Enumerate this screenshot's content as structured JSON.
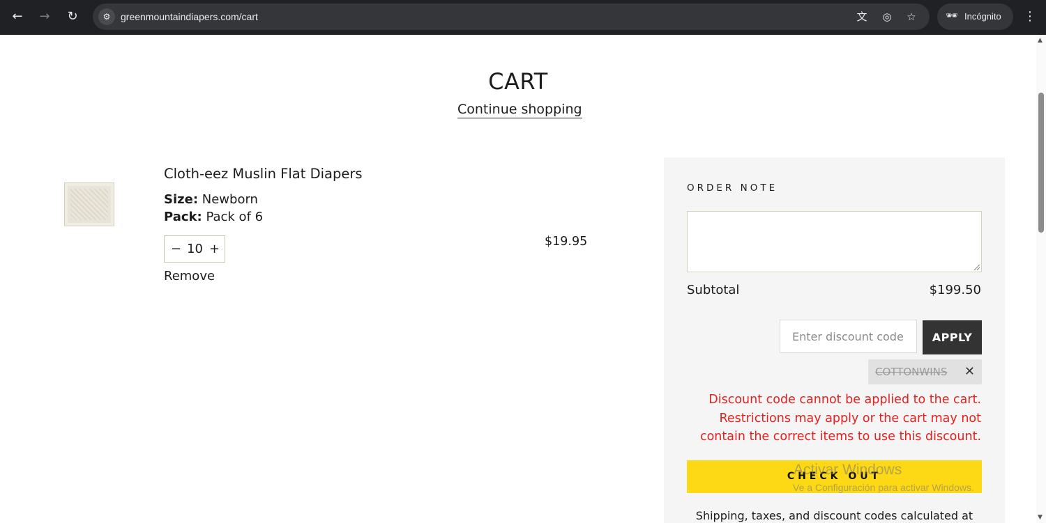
{
  "browser": {
    "url": "greenmountaindiapers.com/cart",
    "profile_label": "Incógnito",
    "back_icon": "←",
    "forward_icon": "→",
    "reload_icon": "↻",
    "site_info_icon": "⚙",
    "translate_icon": "文",
    "eye_off_icon": "◎",
    "star_icon": "☆",
    "incognito_icon": "🕶",
    "menu_icon": "⋮"
  },
  "page": {
    "title": "CART",
    "continue_label": "Continue shopping"
  },
  "item": {
    "name": "Cloth-eez Muslin Flat Diapers",
    "size_label": "Size:",
    "size_value": "Newborn",
    "pack_label": "Pack:",
    "pack_value": "Pack of 6",
    "qty_minus": "−",
    "qty_value": "10",
    "qty_plus": "+",
    "remove_label": "Remove",
    "price": "$19.95"
  },
  "sidebar": {
    "order_note_label": "ORDER NOTE",
    "subtotal_label": "Subtotal",
    "subtotal_value": "$199.50",
    "discount_placeholder": "Enter discount code",
    "apply_label": "APPLY",
    "applied_code": "COTTONWINS",
    "remove_code_icon": "✕",
    "error_message": "Discount code cannot be applied to the cart. Restrictions may apply or the cart may not contain the correct items to use this discount.",
    "checkout_label": "CHECK OUT",
    "shipping_note": "Shipping, taxes, and discount codes calculated at"
  },
  "watermark": {
    "line1": "Activar Windows",
    "line2": "Ve a Configuración para activar Windows."
  },
  "colors": {
    "checkout_bg": "#fdd815",
    "error": "#e22120",
    "apply_bg": "#333333"
  }
}
